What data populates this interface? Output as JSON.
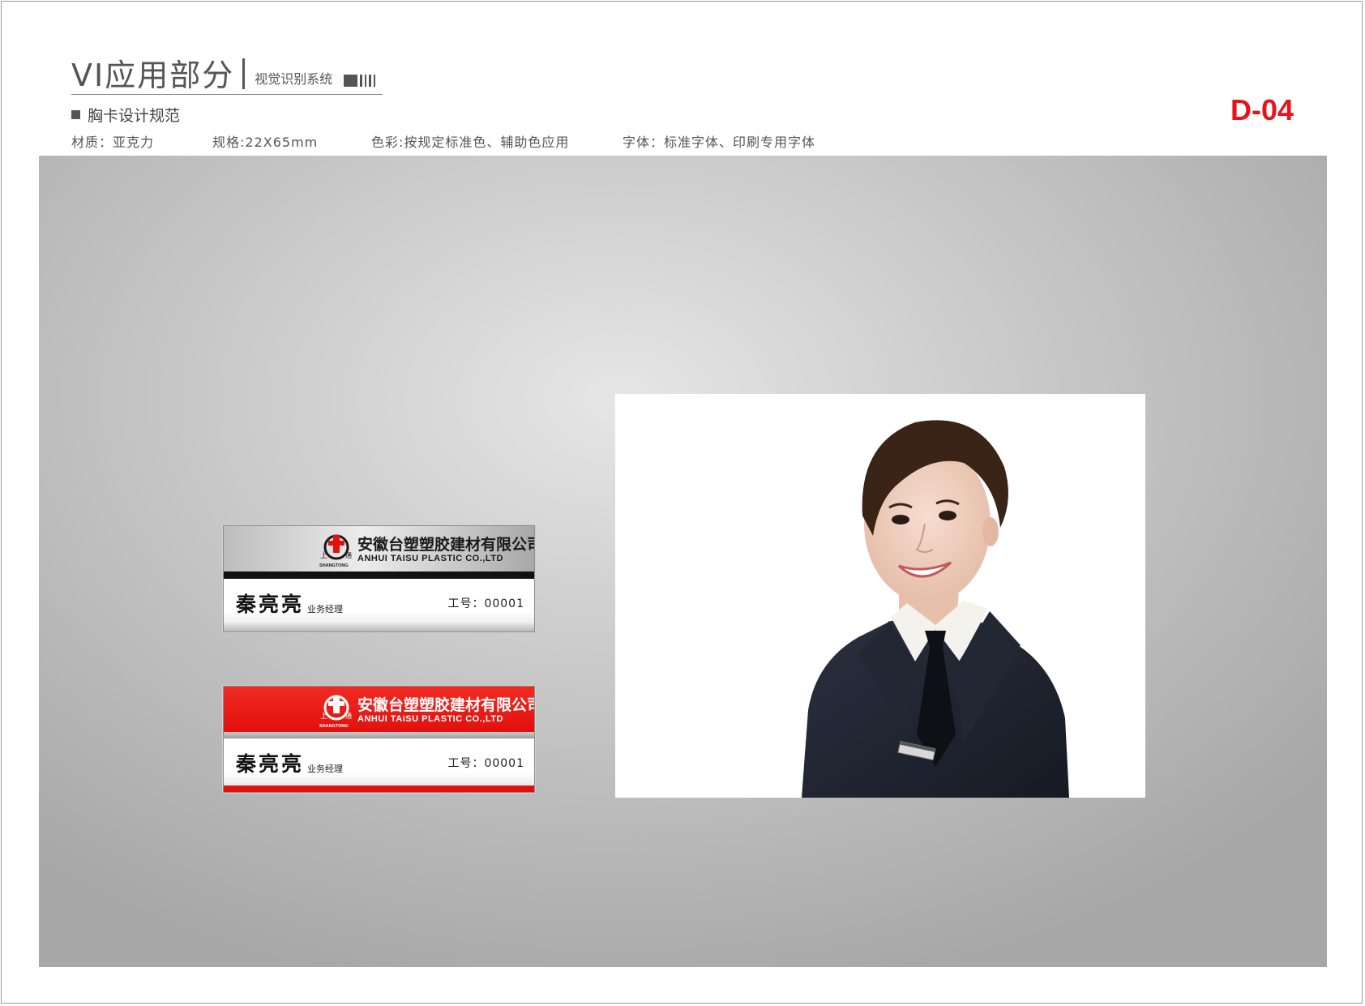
{
  "header": {
    "title": "VI应用部分",
    "subtitle": "视觉识别系统",
    "section": "胸卡设计规范",
    "code": "D-04"
  },
  "specs": {
    "material": "材质：亚克力",
    "size": "规格:22X65mm",
    "color": "色彩:按规定标准色、辅助色应用",
    "font": "字体：标准字体、印刷专用字体"
  },
  "badges": [
    {
      "style": "silver",
      "company_cn": "安徽台塑塑胶建材有限公司",
      "company_en": "ANHUI TAISU PLASTIC CO.,LTD",
      "logo_text": "SHANGTONG",
      "name": "秦亮亮",
      "title": "业务经理",
      "employee_id": "工号：00001"
    },
    {
      "style": "red",
      "company_cn": "安徽台塑塑胶建材有限公司",
      "company_en": "ANHUI TAISU PLASTIC CO.,LTD",
      "logo_text": "SHANGTONG",
      "name": "秦亮亮",
      "title": "业务经理",
      "employee_id": "工号：00001"
    }
  ],
  "colors": {
    "accent_red": "#e8141c",
    "badge_red": "#e2100e"
  }
}
